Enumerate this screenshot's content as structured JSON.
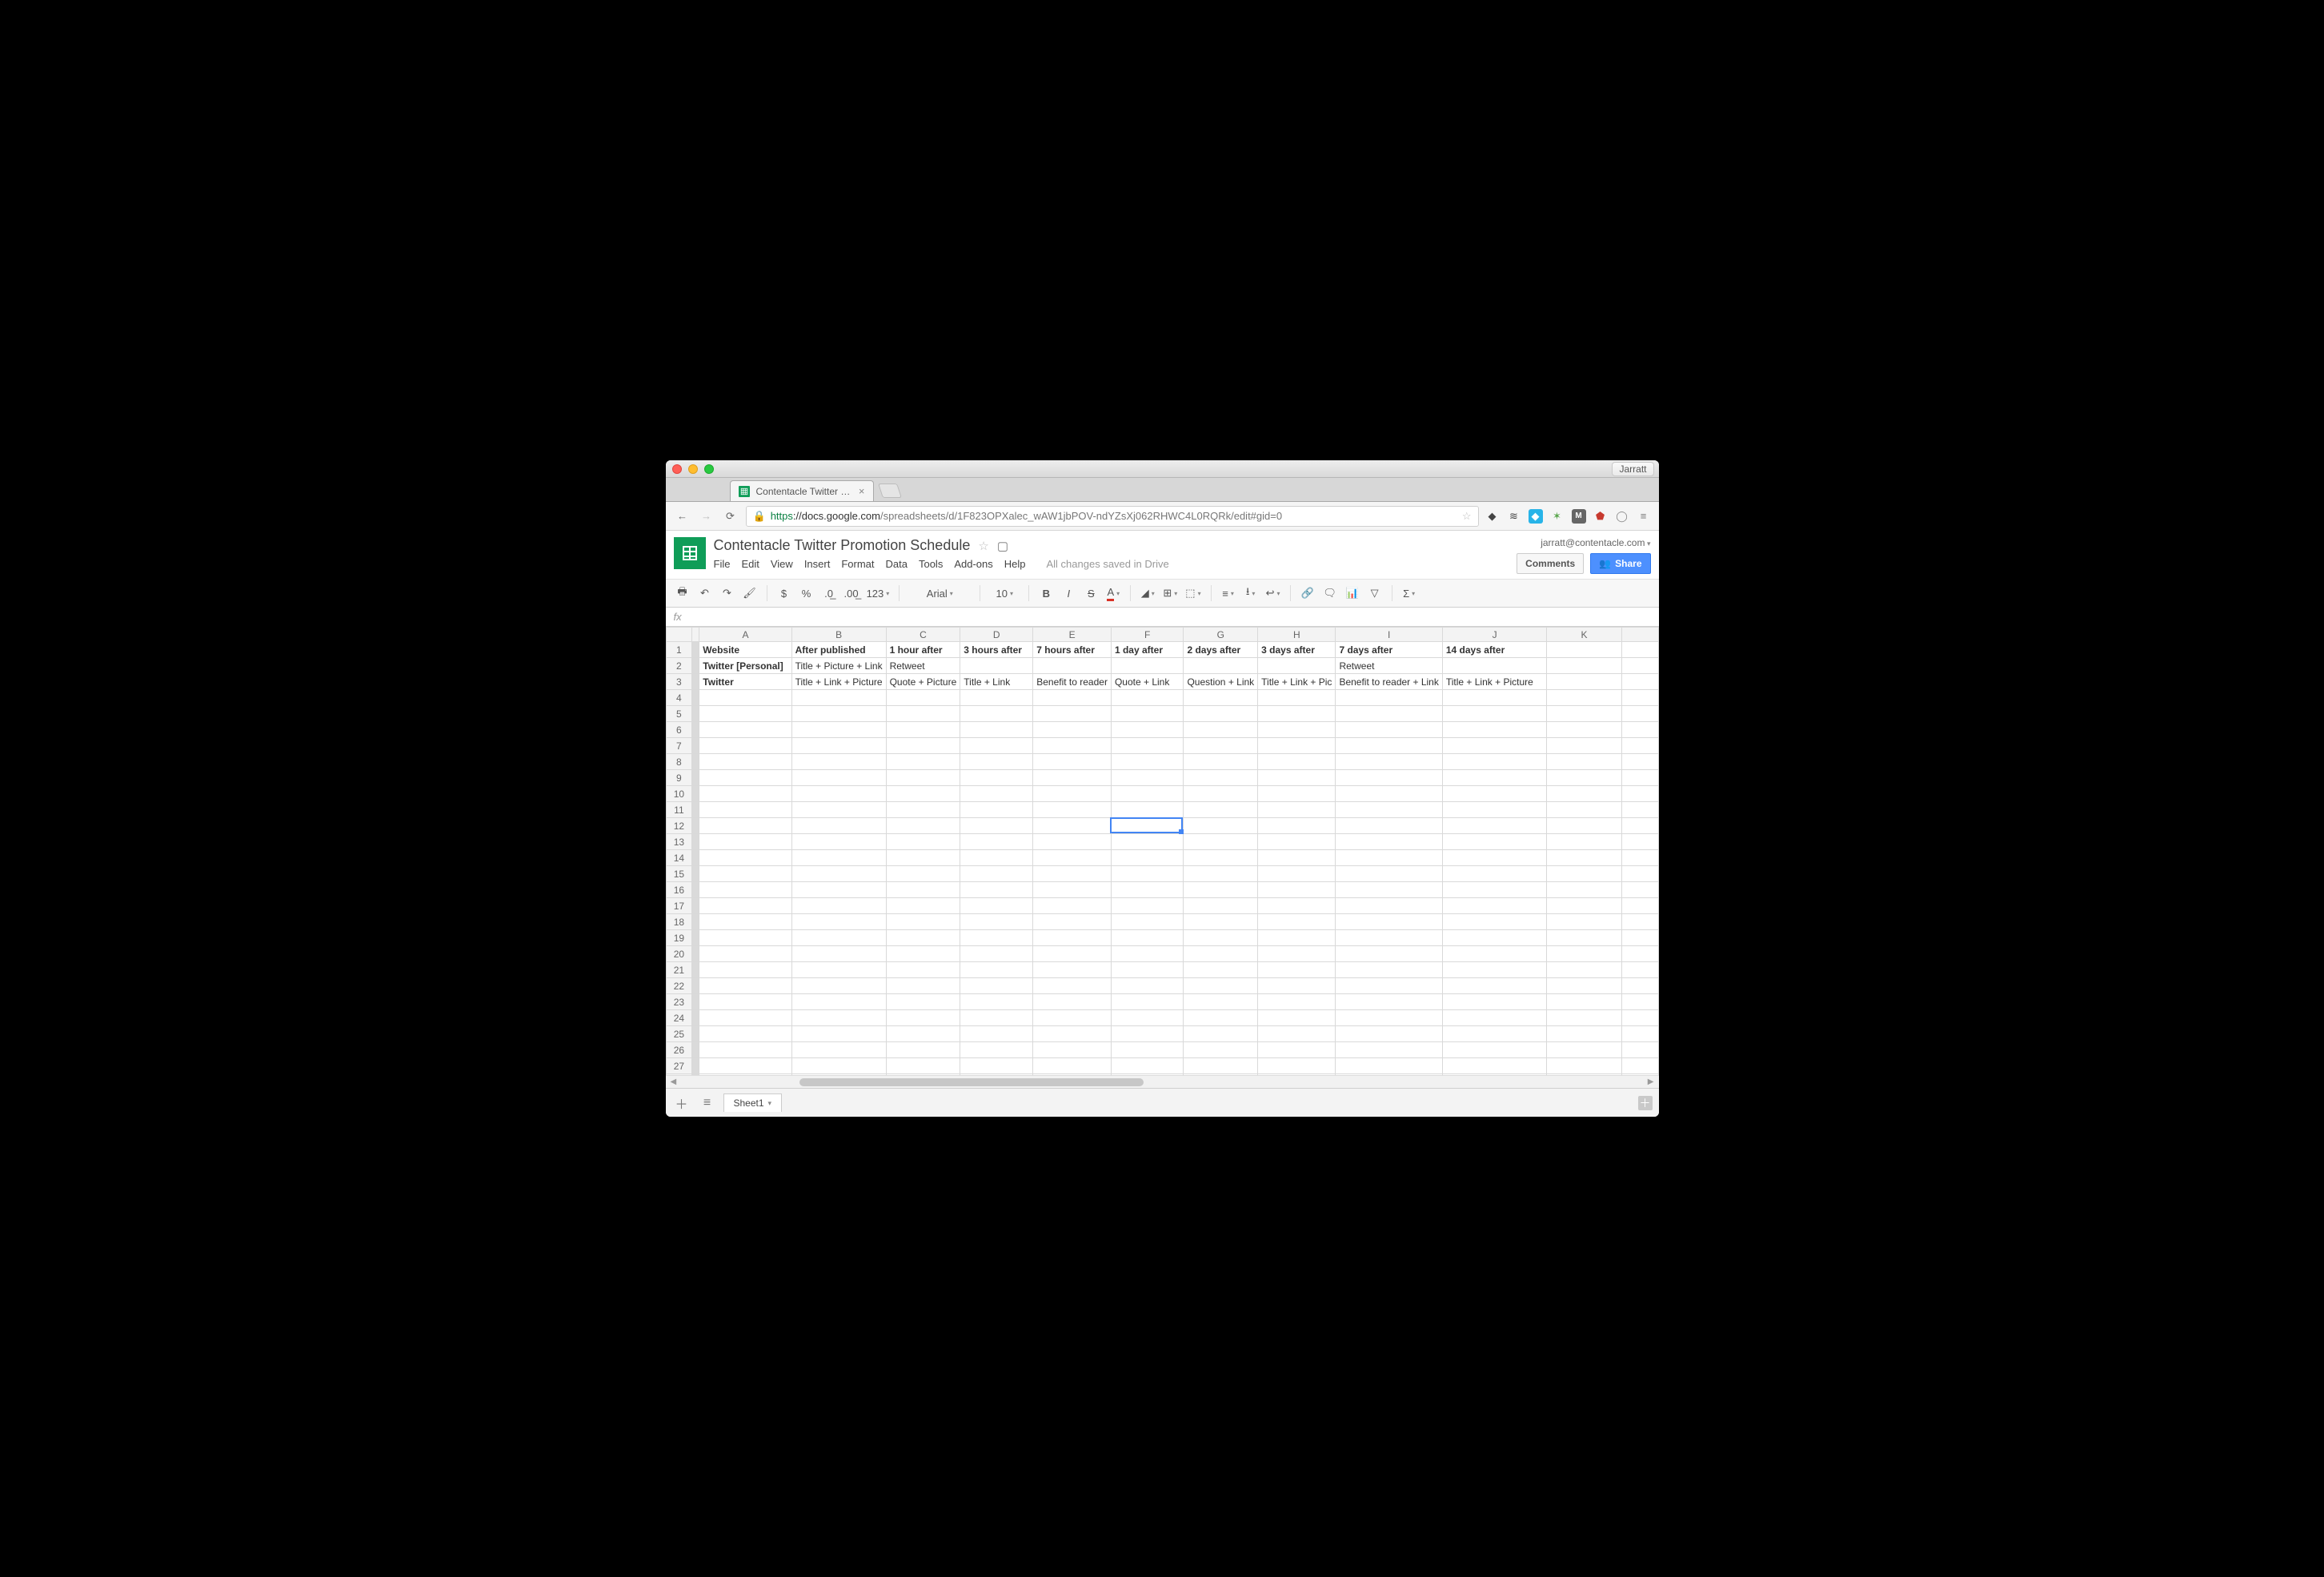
{
  "browser": {
    "profile": "Jarratt",
    "tab_title": "Contentacle Twitter Promot",
    "url_scheme": "https",
    "url_host": "://docs.google.com",
    "url_path": "/spreadsheets/d/1F823OPXalec_wAW1jbPOV-ndYZsXj062RHWC4L0RQRk/edit#gid=0"
  },
  "docs": {
    "title": "Contentacle Twitter Promotion Schedule",
    "user_email": "jarratt@contentacle.com",
    "comments_label": "Comments",
    "share_label": "Share",
    "save_status": "All changes saved in Drive",
    "menus": [
      "File",
      "Edit",
      "View",
      "Insert",
      "Format",
      "Data",
      "Tools",
      "Add-ons",
      "Help"
    ]
  },
  "toolbar": {
    "font_name": "Arial",
    "font_size": "10",
    "number_format_label": "123"
  },
  "fx_label": "fx",
  "sheet": {
    "columns": [
      "A",
      "B",
      "C",
      "D",
      "E",
      "F",
      "G",
      "H",
      "I",
      "J",
      "K"
    ],
    "active_cell": {
      "col": "F",
      "row": 12
    },
    "tab_name": "Sheet1",
    "rows": [
      {
        "n": 1,
        "bold": true,
        "cells": [
          "Website",
          "After published",
          "1 hour after",
          "3 hours after",
          "7 hours after",
          "1 day after",
          "2 days after",
          "3 days after",
          "7 days after",
          "14 days after",
          ""
        ]
      },
      {
        "n": 2,
        "cells": [
          "Twitter [Personal]",
          "Title + Picture + Link",
          "Retweet",
          "",
          "",
          "",
          "",
          "",
          "Retweet",
          "",
          ""
        ],
        "boldA": true
      },
      {
        "n": 3,
        "cells": [
          "Twitter",
          "Title + Link + Picture",
          "Quote + Picture",
          "Title + Link",
          "Benefit to reader",
          "Quote + Link",
          "Question + Link",
          "Title + Link + Pic",
          "Benefit to reader + Link",
          "Title + Link + Picture",
          ""
        ],
        "boldA": true
      }
    ],
    "empty_rows": 26
  }
}
